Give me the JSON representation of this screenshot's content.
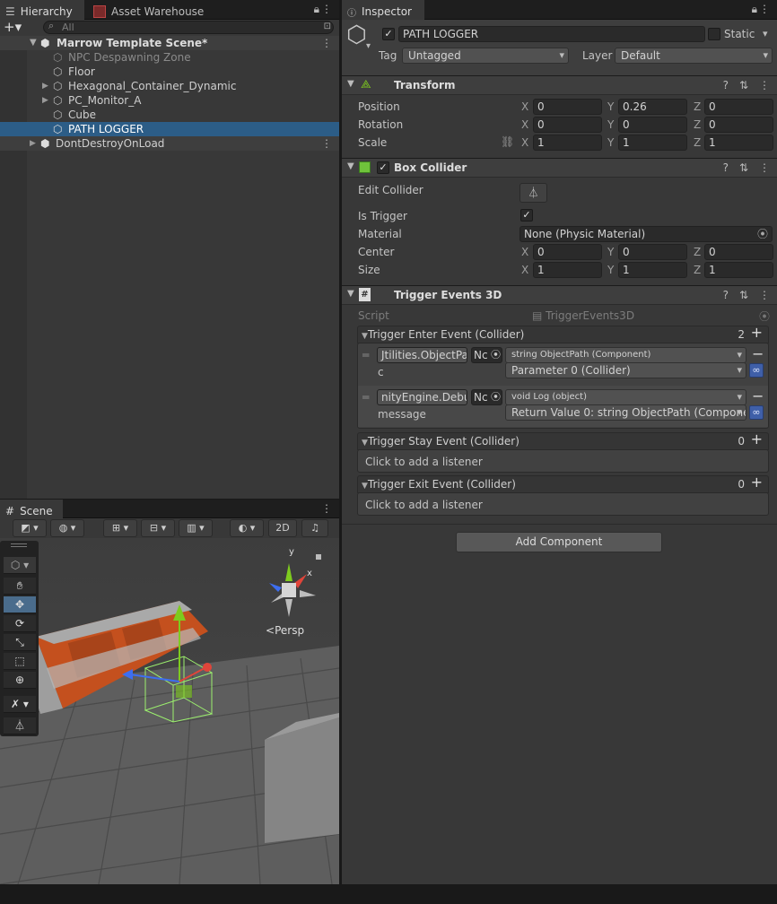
{
  "hierarchy": {
    "tab_label": "Hierarchy",
    "tab2_label": "Asset Warehouse",
    "search_placeholder": "All",
    "scene_name": "Marrow Template Scene*",
    "items": [
      {
        "label": "NPC Despawning Zone"
      },
      {
        "label": "Floor"
      },
      {
        "label": "Hexagonal_Container_Dynamic"
      },
      {
        "label": "PC_Monitor_A"
      },
      {
        "label": "Cube"
      },
      {
        "label": "PATH LOGGER"
      }
    ],
    "dont_destroy": "DontDestroyOnLoad"
  },
  "scene": {
    "tab_label": "Scene",
    "mode_2d": "2D",
    "persp_label": "Persp",
    "gizmo_y": "y",
    "gizmo_x": "x"
  },
  "inspector": {
    "tab_label": "Inspector",
    "object_name": "PATH LOGGER",
    "static_label": "Static",
    "tag_label": "Tag",
    "tag_value": "Untagged",
    "layer_label": "Layer",
    "layer_value": "Default",
    "transform": {
      "title": "Transform",
      "position_label": "Position",
      "rotation_label": "Rotation",
      "scale_label": "Scale",
      "position": {
        "x": "0",
        "y": "0.26",
        "z": "0"
      },
      "rotation": {
        "x": "0",
        "y": "0",
        "z": "0"
      },
      "scale": {
        "x": "1",
        "y": "1",
        "z": "1"
      }
    },
    "axis": {
      "x": "X",
      "y": "Y",
      "z": "Z"
    },
    "box_collider": {
      "title": "Box Collider",
      "edit_collider_label": "Edit Collider",
      "is_trigger_label": "Is Trigger",
      "material_label": "Material",
      "material_value": "None (Physic Material)",
      "center_label": "Center",
      "size_label": "Size",
      "center": {
        "x": "0",
        "y": "0",
        "z": "0"
      },
      "size": {
        "x": "1",
        "y": "1",
        "z": "1"
      }
    },
    "trigger_events": {
      "title": "Trigger Events 3D",
      "script_label": "Script",
      "script_value": "TriggerEvents3D",
      "enter": {
        "label": "Trigger Enter Event (Collider)",
        "count": "2",
        "listeners": [
          {
            "target": "Jtilities.ObjectPa",
            "none": "Nc",
            "function": "string ObjectPath (Component)",
            "param_label": "c",
            "param_value": "Parameter 0 (Collider)"
          },
          {
            "target": "nityEngine.Debu",
            "none": "Nc",
            "function": "void Log (object)",
            "param_label": "message",
            "param_value": "Return Value 0: string ObjectPath (Componer"
          }
        ]
      },
      "stay": {
        "label": "Trigger Stay Event (Collider)",
        "count": "0",
        "empty": "Click to add a listener"
      },
      "exit": {
        "label": "Trigger Exit Event (Collider)",
        "count": "0",
        "empty": "Click to add a listener"
      }
    },
    "add_component": "Add Component"
  },
  "colors": {
    "selection": "#2c5d87",
    "x_axis": "#e0453a",
    "y_axis": "#7ecb1e",
    "z_axis": "#3d6ef0"
  }
}
